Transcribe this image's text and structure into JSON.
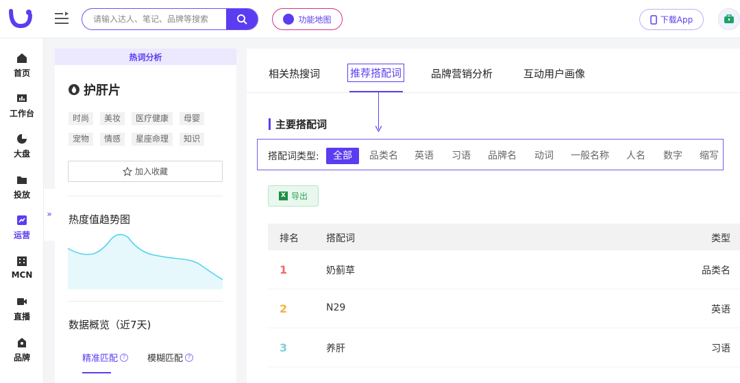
{
  "header": {
    "search_placeholder": "请输入达人、笔记、品牌等搜索",
    "feature_map_label": "功能地图",
    "download_label": "下载App"
  },
  "sidebar": {
    "items": [
      {
        "label": "首页",
        "icon": "home-icon"
      },
      {
        "label": "工作台",
        "icon": "workbench-icon"
      },
      {
        "label": "大盘",
        "icon": "pie-chart-icon"
      },
      {
        "label": "投放",
        "icon": "folder-icon"
      },
      {
        "label": "运营",
        "icon": "trend-icon",
        "active": true
      },
      {
        "label": "MCN",
        "icon": "building-icon"
      },
      {
        "label": "直播",
        "icon": "video-icon"
      },
      {
        "label": "品牌",
        "icon": "brand-icon"
      }
    ],
    "collapse_glyph": "»"
  },
  "left_panel": {
    "header": "热词分析",
    "keyword": "护肝片",
    "tags": [
      "时尚",
      "美妆",
      "医疗健康",
      "母婴",
      "宠物",
      "情感",
      "星座命理",
      "知识"
    ],
    "favorite_label": "加入收藏",
    "trend_title": "热度值趋势图",
    "overview_title": "数据概览（近7天)",
    "match_tabs": [
      "精准匹配",
      "模糊匹配"
    ]
  },
  "main": {
    "tabs": [
      "相关热搜词",
      "推荐搭配词",
      "品牌营销分析",
      "互动用户画像"
    ],
    "active_tab": "推荐搭配词",
    "section_title": "主要搭配词",
    "filter_label": "搭配词类型:",
    "filter_chips": [
      "全部",
      "品类名",
      "英语",
      "习语",
      "品牌名",
      "动词",
      "一般名称",
      "人名",
      "数字",
      "缩写"
    ],
    "export_label": "导出",
    "table": {
      "headers": [
        "排名",
        "搭配词",
        "类型"
      ],
      "rows": [
        {
          "rank": "1",
          "word": "奶蓟草",
          "type": "品类名",
          "color": "#f06a6a"
        },
        {
          "rank": "2",
          "word": "N29",
          "type": "英语",
          "color": "#f0b43c"
        },
        {
          "rank": "3",
          "word": "养肝",
          "type": "习语",
          "color": "#7ccfd8"
        }
      ]
    }
  },
  "colors": {
    "accent": "#5b3cf0",
    "feature_border": "#d0338a",
    "export_green": "#2f9e57"
  }
}
